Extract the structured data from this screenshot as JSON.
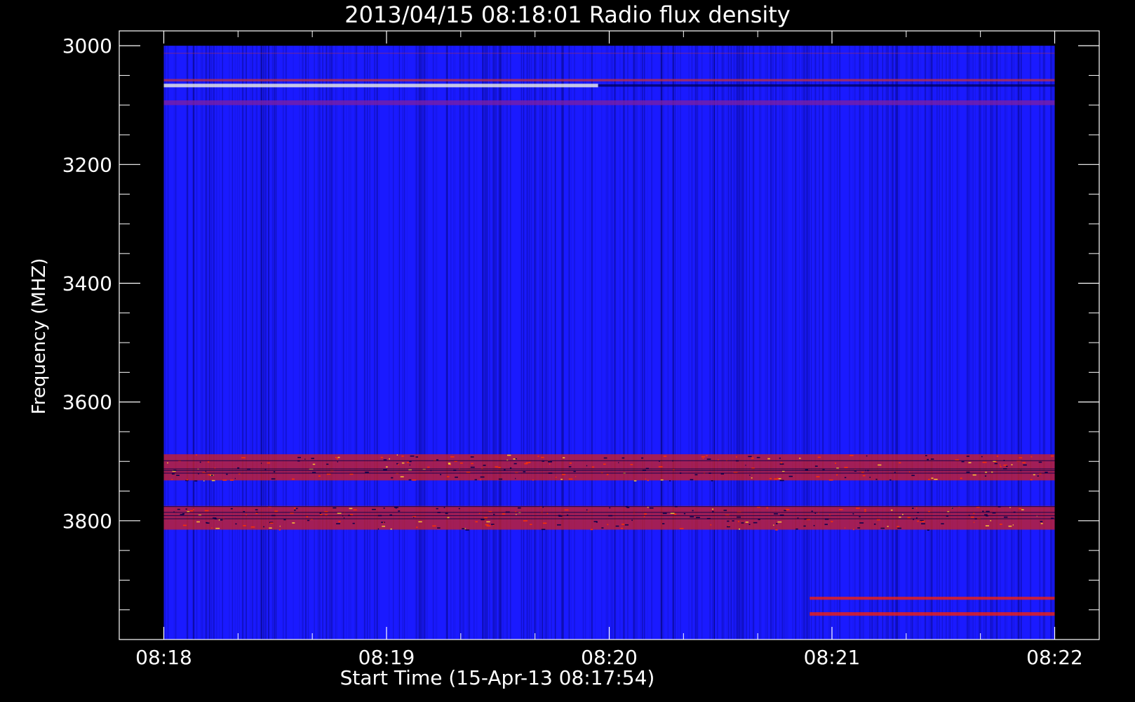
{
  "chart_data": {
    "type": "heatmap",
    "title": "2013/04/15 08:18:01 Radio flux density",
    "xlabel": "Start Time (15-Apr-13 08:17:54)",
    "ylabel": "Frequency (MHZ)",
    "x_ticks": [
      "08:18",
      "08:19",
      "08:20",
      "08:21",
      "08:22"
    ],
    "y_ticks": [
      3000,
      3200,
      3400,
      3600,
      3800
    ],
    "xlim": [
      -0.2,
      4.2
    ],
    "ylim": [
      4000,
      2975
    ],
    "data_x_range": [
      0,
      4.0
    ],
    "data_y_range": [
      3000,
      4000
    ],
    "colors": {
      "background": "#000000",
      "base": "#1a1aff",
      "dark": "#00004a",
      "warm": "#ff3300",
      "hot": "#ffffcc",
      "axis": "#ffffff"
    },
    "bands": [
      {
        "name": "3067 MHz interference line",
        "freq": [
          3064,
          3070
        ],
        "minutes": [
          0.0,
          1.95
        ],
        "color": "#ffffe0"
      },
      {
        "name": "3067 MHz line continuation",
        "freq": [
          3065,
          3069
        ],
        "minutes": [
          1.95,
          4.0
        ],
        "color": "#000050"
      },
      {
        "name": "3058 MHz band",
        "freq": [
          3056,
          3060
        ],
        "minutes": [
          0.0,
          4.0
        ],
        "color": "#c03040"
      },
      {
        "name": "3095 MHz band",
        "freq": [
          3092,
          3100
        ],
        "minutes": [
          0.0,
          4.0
        ],
        "color": "#8020a0"
      },
      {
        "name": "3690-3730 MHz band",
        "freq": [
          3688,
          3732
        ],
        "minutes": [
          0.0,
          4.0
        ],
        "color": "#d02020"
      },
      {
        "name": "3775-3815 MHz band",
        "freq": [
          3775,
          3815
        ],
        "minutes": [
          0.0,
          4.0
        ],
        "color": "#d02020"
      },
      {
        "name": "3930 MHz band",
        "freq": [
          3928,
          3933
        ],
        "minutes": [
          2.9,
          4.0
        ],
        "color": "#ff2200"
      },
      {
        "name": "3957 MHz band",
        "freq": [
          3954,
          3960
        ],
        "minutes": [
          2.9,
          4.0
        ],
        "color": "#ff2200"
      }
    ]
  }
}
